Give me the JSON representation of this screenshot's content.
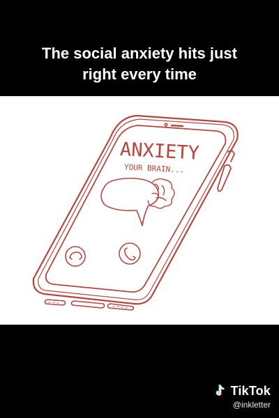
{
  "caption": {
    "line1": "The social anxiety hits just",
    "line2": "right every time"
  },
  "illustration": {
    "caller_name": "ANXIETY",
    "caller_subtitle": "YOUR BRAIN...",
    "colors": {
      "ink": "#b5453e",
      "background": "#ffffff"
    }
  },
  "watermark": {
    "brand": "TikTok",
    "handle": "@inkletter",
    "icon": "tiktok-logo-icon"
  }
}
